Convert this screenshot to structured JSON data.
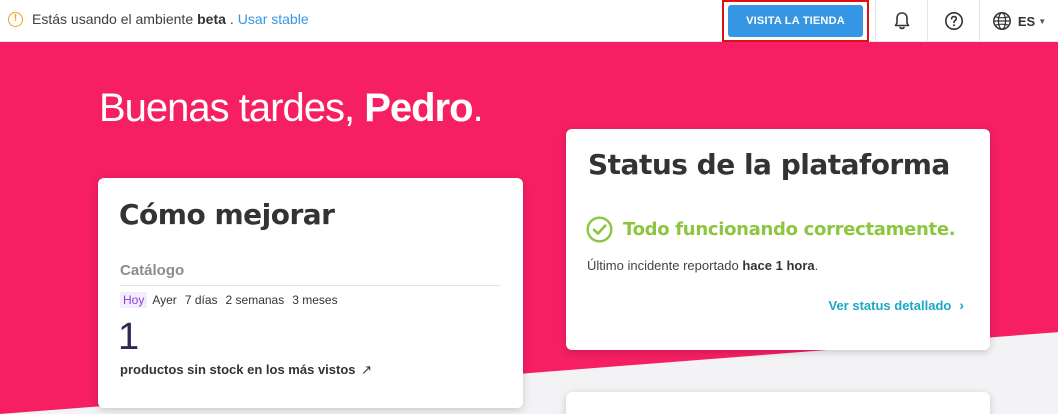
{
  "topbar": {
    "env_prefix": "Estás usando el ambiente",
    "env_name": "beta",
    "env_suffix": ".",
    "env_link": "Usar stable",
    "store_button": "VISITA LA TIENDA",
    "lang": "ES",
    "icons": [
      "warning-icon",
      "bell-icon",
      "help-icon",
      "globe-icon",
      "chevron-down-icon"
    ]
  },
  "greeting": {
    "prefix": "Buenas tardes, ",
    "name": "Pedro",
    "suffix": "."
  },
  "improve_card": {
    "title": "Cómo mejorar",
    "section": "Catálogo",
    "periods": [
      "Hoy",
      "Ayer",
      "7 días",
      "2 semanas",
      "3 meses"
    ],
    "active_period": "Hoy",
    "count": "1",
    "stat_label": "productos sin stock en los más vistos",
    "stat_arrow": "↗"
  },
  "status_card": {
    "title": "Status de la plataforma",
    "ok_text": "Todo funcionando correctamente.",
    "incident_prefix": "Último incidente reportado ",
    "incident_time": "hace 1 hora",
    "incident_suffix": ".",
    "detail_link": "Ver status detallado",
    "detail_chevron": "›"
  },
  "colors": {
    "hero": "#f61f63",
    "accent_blue": "#3597e3",
    "ok_green": "#8cc63f",
    "link_teal": "#1ba7c7",
    "warning": "#f0a020"
  }
}
